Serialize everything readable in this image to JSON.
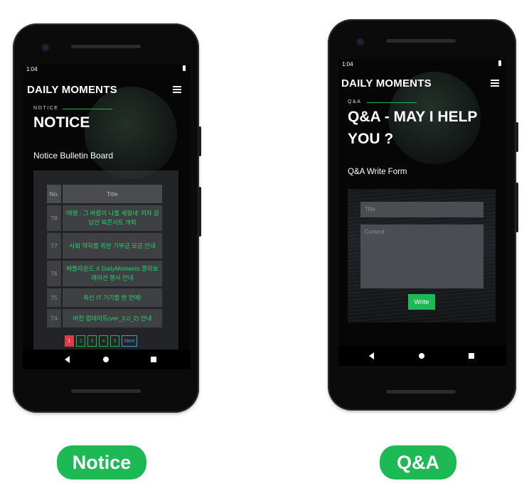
{
  "notice_screen": {
    "status_time": "1:04",
    "brand": "DAILY MOMENTS",
    "kicker": "NOTICE",
    "headline": "NOTICE",
    "subheading": "Notice Bulletin Board",
    "table": {
      "headers": [
        "No.",
        "Title"
      ],
      "rows": [
        {
          "no": "78",
          "title": "'여행 : 그 바람이 나를 세웠네' 저자 강남선 북콘서트 개최"
        },
        {
          "no": "77",
          "title": "사회 약자를 위한 기부금 모금 안내"
        },
        {
          "no": "76",
          "title": "배틀라운드 X DailyMoments 콜라보레이션 행사 안내"
        },
        {
          "no": "75",
          "title": "최신 IT 기기를 한 번에!"
        },
        {
          "no": "74",
          "title": "버전 업데이트(ver_3.0_2) 안내"
        }
      ]
    },
    "pagination": {
      "pages": [
        "1",
        "2",
        "3",
        "4",
        "5"
      ],
      "active": "1",
      "next_label": "Next"
    }
  },
  "qa_screen": {
    "status_time": "1:04",
    "brand": "DAILY MOMENTS",
    "kicker": "Q&A",
    "headline_line1": "Q&A - MAY I HELP",
    "headline_line2": "YOU ?",
    "subheading": "Q&A Write Form",
    "form": {
      "title_placeholder": "Title",
      "content_placeholder": "Content",
      "submit_label": "Write"
    }
  },
  "captions": {
    "left": "Notice",
    "right": "Q&A"
  },
  "colors": {
    "accent": "#1db954",
    "active_page": "#e03a4a",
    "next_link": "#3aa0d8"
  }
}
